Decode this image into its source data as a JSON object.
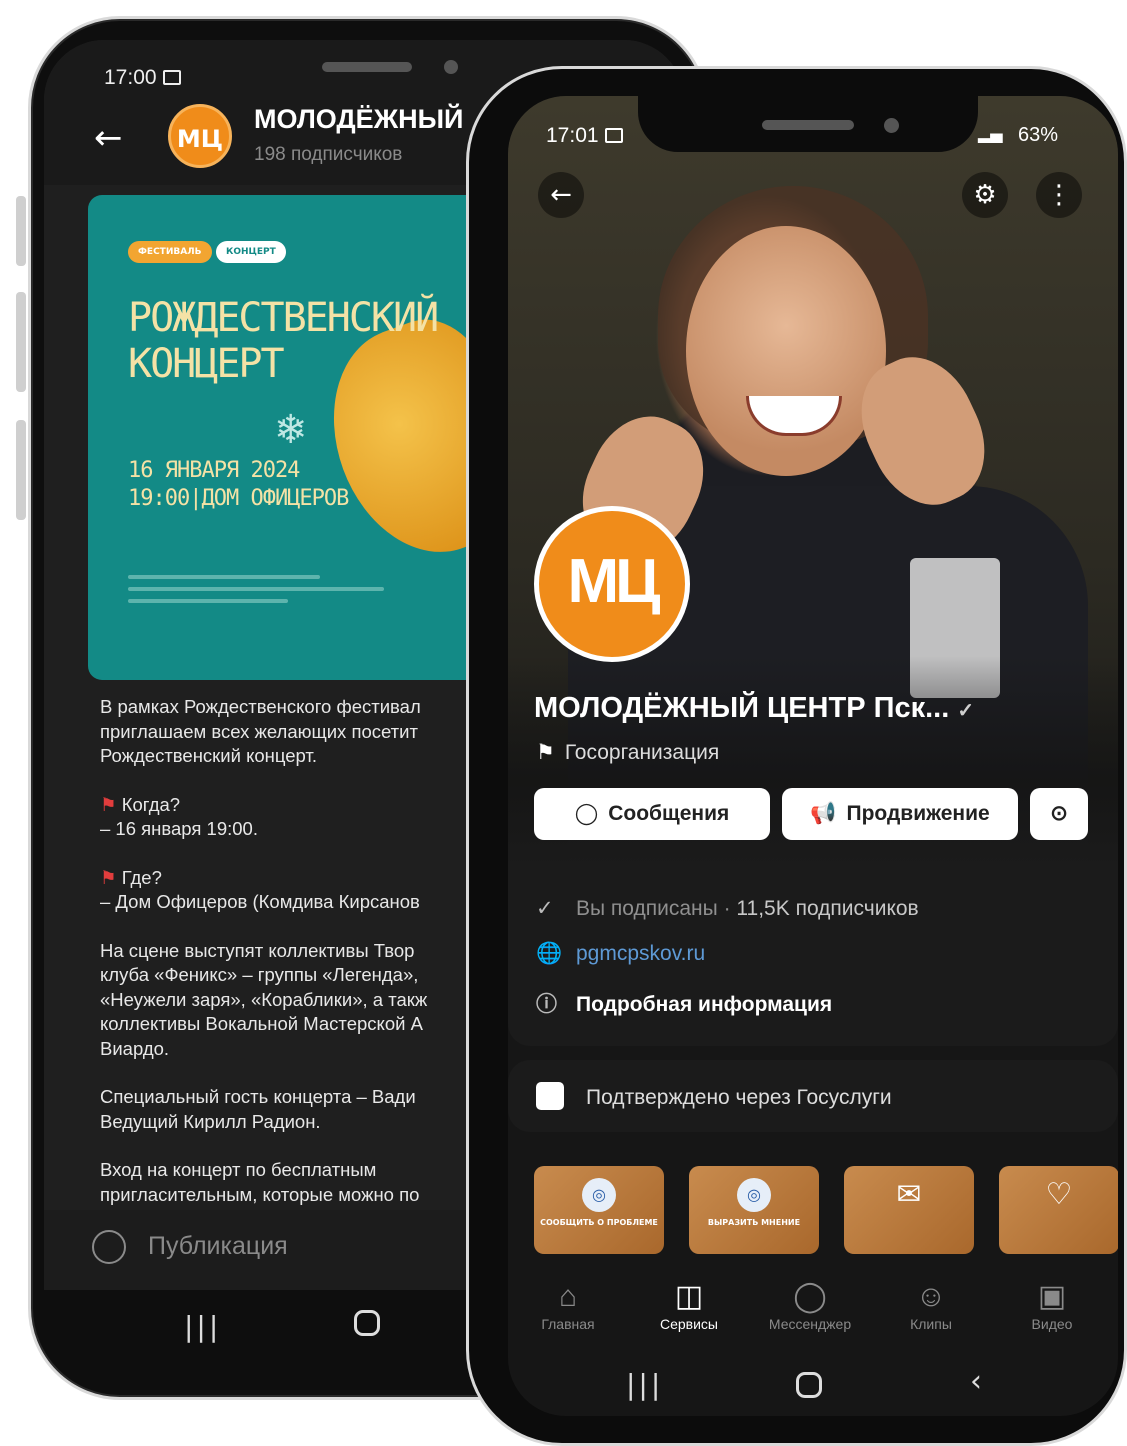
{
  "back_phone": {
    "status_time": "17:00",
    "header": {
      "logo_text": "МЦ",
      "title": "МОЛОДЁЖНЫЙ",
      "subscribers": "198 подписчиков"
    },
    "poster": {
      "tag_festival": "ФЕСТИВАЛЬ",
      "tag_concert": "КОНЦЕРТ",
      "title_line1": "РОЖДЕСТВЕНСКИЙ",
      "title_line2": "КОНЦЕРТ",
      "date_line1": "16 ЯНВАРЯ 2024",
      "date_line2": "19:00|ДОМ ОФИЦЕРОВ"
    },
    "post_text": {
      "p1_l1": "В рамках Рождественского фестивал",
      "p1_l2": "приглашаем всех желающих посетит",
      "p1_l3": "Рождественский концерт.",
      "p2_l1": "Когда?",
      "p2_l2": "– 16 января 19:00.",
      "p3_l1": "Где?",
      "p3_l2": "– Дом Офицеров (Комдива Кирсанов",
      "p4_l1": "На сцене выступят коллективы Твор",
      "p4_l2": "клуба «Феникс» – группы «Легенда»,",
      "p4_l3": "«Неужели заря», «Кораблики», а такж",
      "p4_l4": "коллективы Вокальной Мастерской А",
      "p4_l5": "Виардо.",
      "p5_l1": "Специальный гость концерта – Вади",
      "p5_l2": "Ведущий Кирилл Радион.",
      "p6_l1": "Вход на концерт по бесплатным",
      "p6_l2": "пригласительным, которые можно по"
    },
    "publication_label": "Публикация"
  },
  "front_phone": {
    "status_time": "17:01",
    "battery": "63%",
    "avatar_text": "МЦ",
    "org_name": "МОЛОДЁЖНЫЙ ЦЕНТР Пск...",
    "verified_icon": "checkmark-icon",
    "org_type": "Госорганизация",
    "buttons": {
      "messages": "Сообщения",
      "promotion": "Продвижение"
    },
    "info": {
      "subscribed": "Вы подписаны · ",
      "subscriber_count": "11,5K подписчиков",
      "website": "pgmcpskov.ru",
      "details": "Подробная информация"
    },
    "gosuslugi": "Подтверждено через Госуслуги",
    "tiles": [
      {
        "label": "СООБЩИТЬ О ПРОБЛЕМЕ",
        "icon": "gosuslugi-icon"
      },
      {
        "label": "ВЫРАЗИТЬ МНЕНИЕ",
        "icon": "gosuslugi-icon"
      },
      {
        "label": "",
        "icon": "mail-icon"
      },
      {
        "label": "",
        "icon": "handshake-icon"
      }
    ],
    "tabs": [
      {
        "label": "Главная",
        "icon": "home-icon"
      },
      {
        "label": "Сервисы",
        "icon": "services-icon"
      },
      {
        "label": "Мессенджер",
        "icon": "chat-icon"
      },
      {
        "label": "Клипы",
        "icon": "clips-icon"
      },
      {
        "label": "Видео",
        "icon": "video-icon"
      }
    ],
    "active_tab": "Сервисы"
  },
  "colors": {
    "brand_orange": "#f08c1a",
    "poster_teal": "#138a86",
    "link_blue": "#5e9ad6",
    "flag_red": "#e23d3d"
  }
}
